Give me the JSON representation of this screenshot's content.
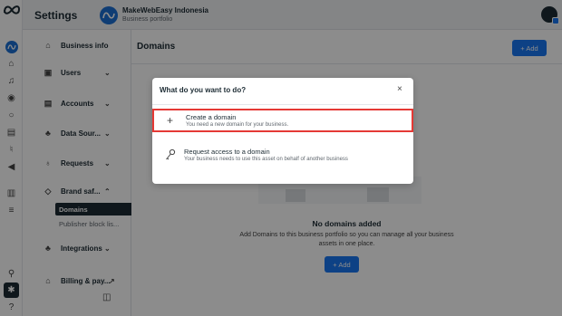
{
  "header": {
    "title": "Settings",
    "business_name": "MakeWebEasy Indonesia",
    "business_subtitle": "Business portfolio"
  },
  "rail": {
    "icons": [
      "meta-logo-icon",
      "home-icon",
      "bell-icon",
      "ads-icon",
      "circle-icon",
      "pages-icon",
      "tag-icon",
      "megaphone-icon",
      "chart-icon",
      "menu-icon",
      "search-icon",
      "settings-icon",
      "help-icon"
    ]
  },
  "sidebar": {
    "items": [
      {
        "label": "Business info"
      },
      {
        "label": "Users"
      },
      {
        "label": "Accounts"
      },
      {
        "label": "Data Sour..."
      },
      {
        "label": "Requests"
      },
      {
        "label": "Brand saf..."
      },
      {
        "label": "Integrations"
      },
      {
        "label": "Billing & pay..."
      }
    ],
    "subitems": [
      {
        "label": "Domains"
      },
      {
        "label": "Publisher block lis..."
      }
    ]
  },
  "main": {
    "title": "Domains",
    "add_label": "+ Add",
    "empty_title": "No domains added",
    "empty_desc": "Add Domains to this business portfolio so you can manage all your business assets in one place.",
    "empty_add_label": "+ Add"
  },
  "modal": {
    "title": "What do you want to do?",
    "close": "×",
    "options": [
      {
        "label": "Create a domain",
        "desc": "You need a new domain for your business.",
        "icon": "plus-icon"
      },
      {
        "label": "Request access to a domain",
        "desc": "Your business needs to use this asset on behalf of another business",
        "icon": "key-icon"
      }
    ]
  },
  "colors": {
    "accent": "#1877f2",
    "highlight": "#e53935",
    "dark": "#1c2b33"
  }
}
